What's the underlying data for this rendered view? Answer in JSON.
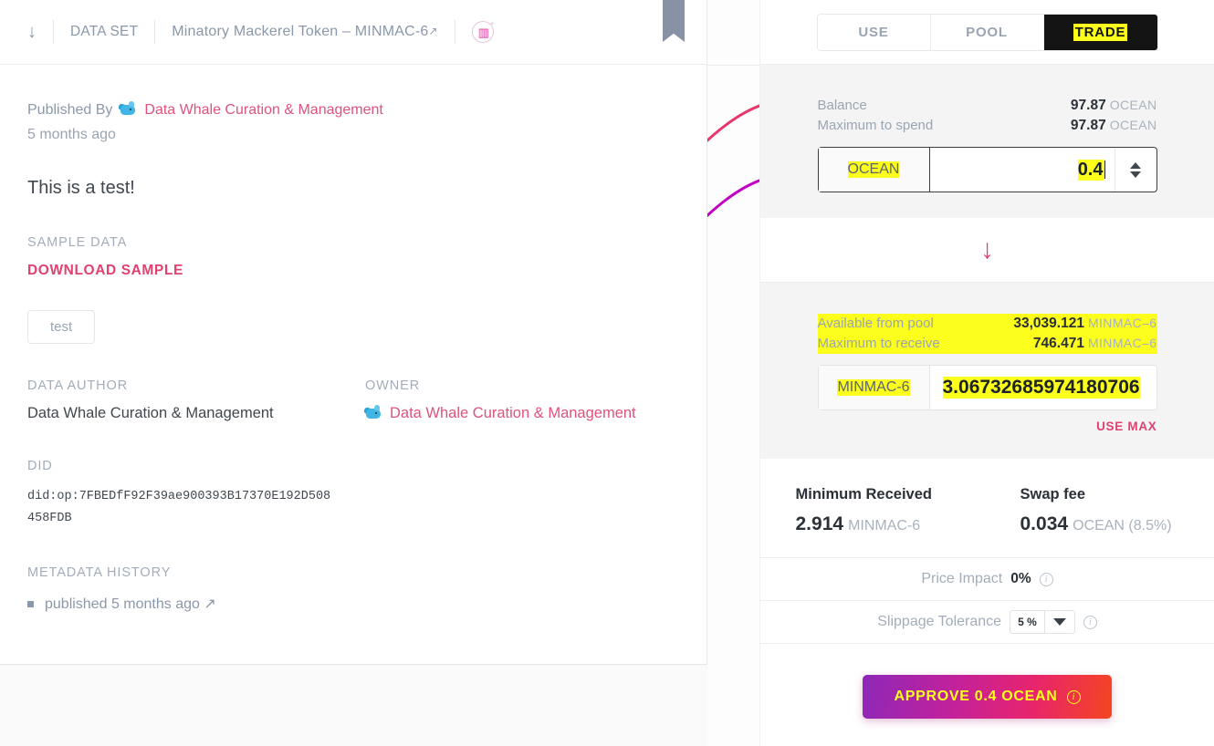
{
  "breadcrumb": {
    "back_icon": "arrow-down-icon",
    "type_label": "DATA SET",
    "asset_name": "Minatory Mackerel Token – MINMAC-6",
    "external_link_glyph": "↗",
    "token_badge_glyph": "▥",
    "token_badge_plus": "+"
  },
  "asset": {
    "published_by_label": "Published By",
    "publisher": "Data Whale Curation & Management",
    "time_ago": "5 months ago",
    "description": "This is a test!",
    "sample_data_label": "SAMPLE DATA",
    "download_sample_label": "DOWNLOAD SAMPLE",
    "tag": "test",
    "data_author_label": "DATA AUTHOR",
    "data_author": "Data Whale Curation & Management",
    "owner_label": "OWNER",
    "owner": "Data Whale Curation & Management",
    "did_label": "DID",
    "did_value": "did:op:7FBEDfF92F39ae900393B17370E192D508458FDB",
    "metadata_history_label": "METADATA HISTORY",
    "history_item": "published 5 months ago ↗"
  },
  "trade": {
    "tabs": [
      {
        "label": "USE",
        "active": false
      },
      {
        "label": "POOL",
        "active": false
      },
      {
        "label": "TRADE",
        "active": true
      }
    ],
    "spend": {
      "balance_label": "Balance",
      "balance_value": "97.87",
      "balance_unit": "OCEAN",
      "max_spend_label": "Maximum to spend",
      "max_spend_value": "97.87",
      "max_spend_unit": "OCEAN",
      "token_prefix": "OCEAN",
      "amount": "0.4"
    },
    "swap_arrow": "↓",
    "receive": {
      "available_label": "Available from pool",
      "available_value": "33,039.121",
      "available_unit": "MINMAC–6",
      "max_receive_label": "Maximum to receive",
      "max_receive_value": "746.471",
      "max_receive_unit": "MINMAC–6",
      "token_prefix": "MINMAC-6",
      "amount": "3.06732685974180706",
      "use_max_label": "USE MAX"
    },
    "stats": [
      {
        "title": "Minimum Received",
        "value": "2.914",
        "unit": "MINMAC-6"
      },
      {
        "title": "Swap fee",
        "value": "0.034",
        "unit": "OCEAN (8.5%)"
      }
    ],
    "price_impact_label": "Price Impact",
    "price_impact_value": "0%",
    "slippage_label": "Slippage Tolerance",
    "slippage_value": "5 %",
    "cta_label": "APPROVE 0.4 OCEAN"
  },
  "colors": {
    "accent_pink": "#e0416f",
    "highlight_yellow": "#fbff1b",
    "tab_active_bg": "#141414",
    "panel_bg": "#f4f4f5"
  }
}
